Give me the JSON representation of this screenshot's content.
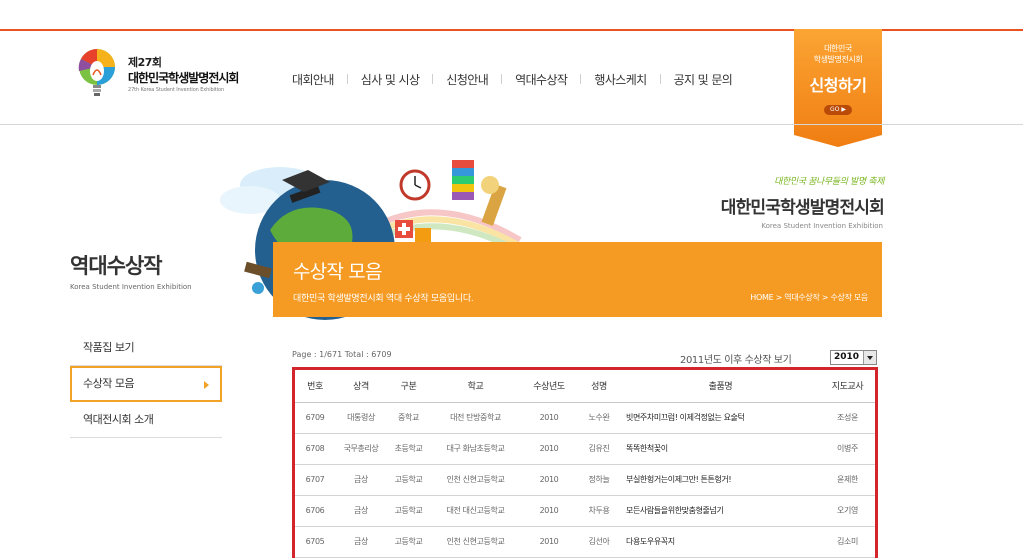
{
  "logo": {
    "line1": "제27회",
    "line2": "대한민국학생발명전시회",
    "line3": "27th Korea Student Invention Exhibition"
  },
  "nav": {
    "items": [
      "대회안내",
      "심사 및 시상",
      "신청안내",
      "역대수상작",
      "행사스케치",
      "공지 및 문의"
    ]
  },
  "apply": {
    "line1": "대한민국",
    "line2": "학생발명전시회",
    "main": "신청하기",
    "go": "GO ▶"
  },
  "brand": {
    "slogan": "대한민국 꿈나무들의 발명 축제",
    "title": "대한민국학생발명전시회",
    "subtitle": "Korea Student Invention Exhibition"
  },
  "side": {
    "title": "역대수상작",
    "subtitle": "Korea Student Invention Exhibition",
    "menu": [
      "작품집 보기",
      "수상작 모음",
      "역대전시회 소개"
    ]
  },
  "banner": {
    "title": "수상작 모음",
    "desc": "대한민국 학생발명전시회 역대 수상작 모음입니다.",
    "breadcrumb": "HOME > 역대수상작 > 수상작 모음"
  },
  "list": {
    "page_info": "Page : 1/671   Total : 6709",
    "since_label": "2011년도 이후 수상작 보기",
    "year_value": "2010",
    "headers": [
      "번호",
      "상격",
      "구분",
      "학교",
      "수상년도",
      "성명",
      "출품명",
      "지도교사"
    ],
    "rows": [
      [
        "6709",
        "대통령상",
        "중학교",
        "대전 탄방중학교",
        "2010",
        "노수완",
        "빗면주차미끄럼! 이제걱정없는 요술턱",
        "조성윤"
      ],
      [
        "6708",
        "국무총리상",
        "초등학교",
        "대구 화남초등학교",
        "2010",
        "김유진",
        "똑똑한척꽂이",
        "이병주"
      ],
      [
        "6707",
        "금상",
        "고등학교",
        "인천 신현고등학교",
        "2010",
        "정하늘",
        "부실한헝거는이제그만! 튼튼헝거!",
        "윤제한"
      ],
      [
        "6706",
        "금상",
        "고등학교",
        "대전 대신고등학교",
        "2010",
        "차두용",
        "모든사람들을위한맞춤형줄넘기",
        "오기영"
      ],
      [
        "6705",
        "금상",
        "고등학교",
        "인천 신현고등학교",
        "2010",
        "김선아",
        "다용도우유꼭지",
        "김소미"
      ]
    ]
  },
  "colors": {
    "accent_orange": "#f59a22",
    "top_line": "#e8531f",
    "highlight_red": "#d2262c"
  }
}
